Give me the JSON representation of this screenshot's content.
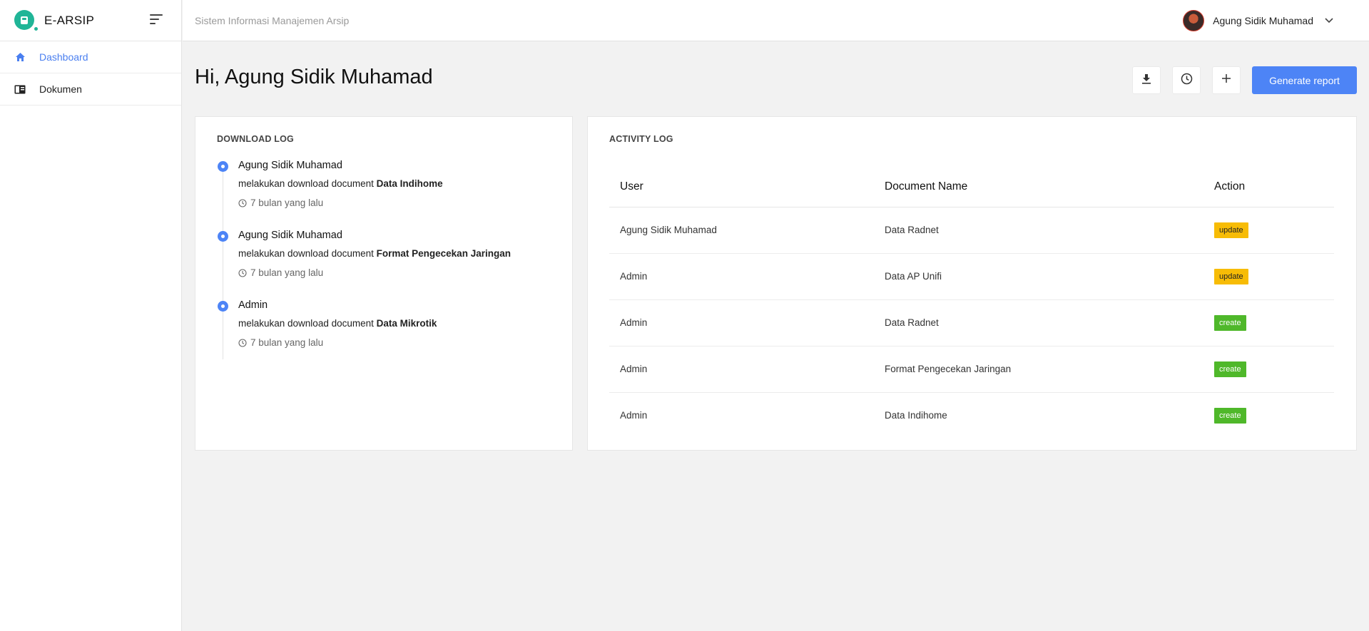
{
  "brand": {
    "name": "E-ARSIP",
    "color": "#20b597"
  },
  "sidebar": {
    "items": [
      {
        "label": "Dashboard",
        "icon": "home-icon",
        "active": true
      },
      {
        "label": "Dokumen",
        "icon": "document-icon",
        "active": false
      }
    ]
  },
  "topbar": {
    "subtitle": "Sistem Informasi Manajemen Arsip",
    "user_name": "Agung Sidik Muhamad"
  },
  "main": {
    "title": "Hi, Agung Sidik Muhamad",
    "actions": {
      "download_icon": "download-icon",
      "history_icon": "clock-icon",
      "add_icon": "plus-icon",
      "generate_label": "Generate report"
    }
  },
  "download_log": {
    "title": "DOWNLOAD LOG",
    "items": [
      {
        "user": "Agung Sidik Muhamad",
        "prefix": "melakukan download document",
        "document": "Data Indihome",
        "time": "7 bulan yang lalu"
      },
      {
        "user": "Agung Sidik Muhamad",
        "prefix": "melakukan download document",
        "document": "Format Pengecekan Jaringan",
        "time": "7 bulan yang lalu"
      },
      {
        "user": "Admin",
        "prefix": "melakukan download document",
        "document": "Data Mikrotik",
        "time": "7 bulan yang lalu"
      }
    ]
  },
  "activity_log": {
    "title": "ACTIVITY LOG",
    "columns": [
      "User",
      "Document Name",
      "Action"
    ],
    "rows": [
      {
        "user": "Agung Sidik Muhamad",
        "document": "Data Radnet",
        "action": "update"
      },
      {
        "user": "Admin",
        "document": "Data AP Unifi",
        "action": "update"
      },
      {
        "user": "Admin",
        "document": "Data Radnet",
        "action": "create"
      },
      {
        "user": "Admin",
        "document": "Format Pengecekan Jaringan",
        "action": "create"
      },
      {
        "user": "Admin",
        "document": "Data Indihome",
        "action": "create"
      }
    ]
  },
  "colors": {
    "accent": "#4d84f6",
    "update": "#f7bc06",
    "create": "#4fb82a"
  }
}
